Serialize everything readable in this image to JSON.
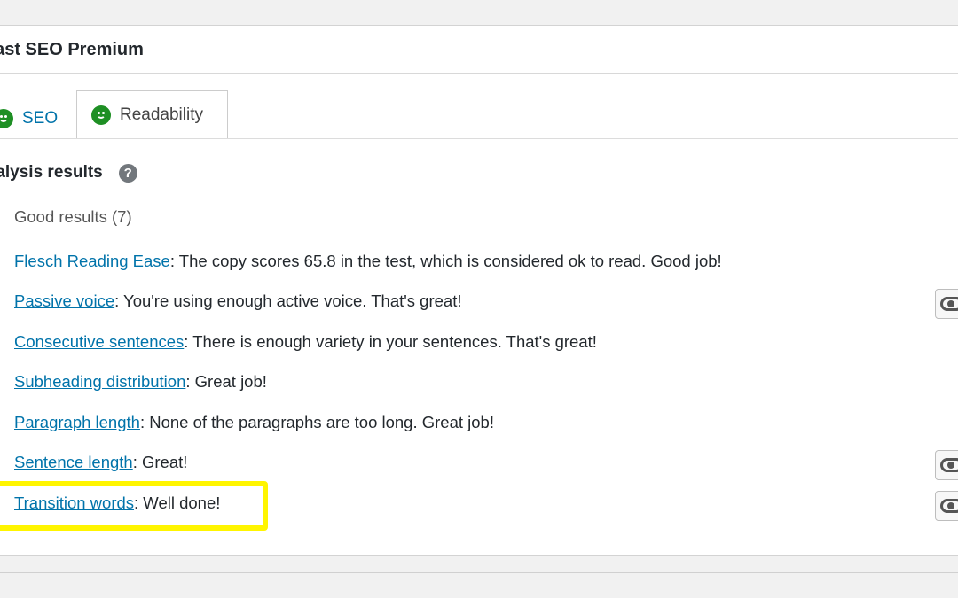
{
  "panel": {
    "title": "Yoast SEO Premium"
  },
  "tabs": [
    {
      "label": "SEO",
      "icon": "smiley-good-icon",
      "active": false
    },
    {
      "label": "Readability",
      "icon": "smiley-good-icon",
      "active": true
    }
  ],
  "analysis": {
    "heading": "Analysis results",
    "help_symbol": "?",
    "group_label": "Good results (7)",
    "results": [
      {
        "link": "Flesch Reading Ease",
        "text": ": The copy scores 65.8 in the test, which is considered ok to read. Good job!",
        "has_eye_button": false
      },
      {
        "link": "Passive voice",
        "text": ": You're using enough active voice. That's great!",
        "has_eye_button": true
      },
      {
        "link": "Consecutive sentences",
        "text": ": There is enough variety in your sentences. That's great!",
        "has_eye_button": false
      },
      {
        "link": "Subheading distribution",
        "text": ": Great job!",
        "has_eye_button": false
      },
      {
        "link": "Paragraph length",
        "text": ": None of the paragraphs are too long. Great job!",
        "has_eye_button": false
      },
      {
        "link": "Sentence length",
        "text": ": Great!",
        "has_eye_button": true
      },
      {
        "link": "Transition words",
        "text": ": Well done!",
        "has_eye_button": true
      }
    ]
  },
  "colors": {
    "link": "#0073aa",
    "good": "#1e8f24",
    "highlight": "#fff500"
  }
}
